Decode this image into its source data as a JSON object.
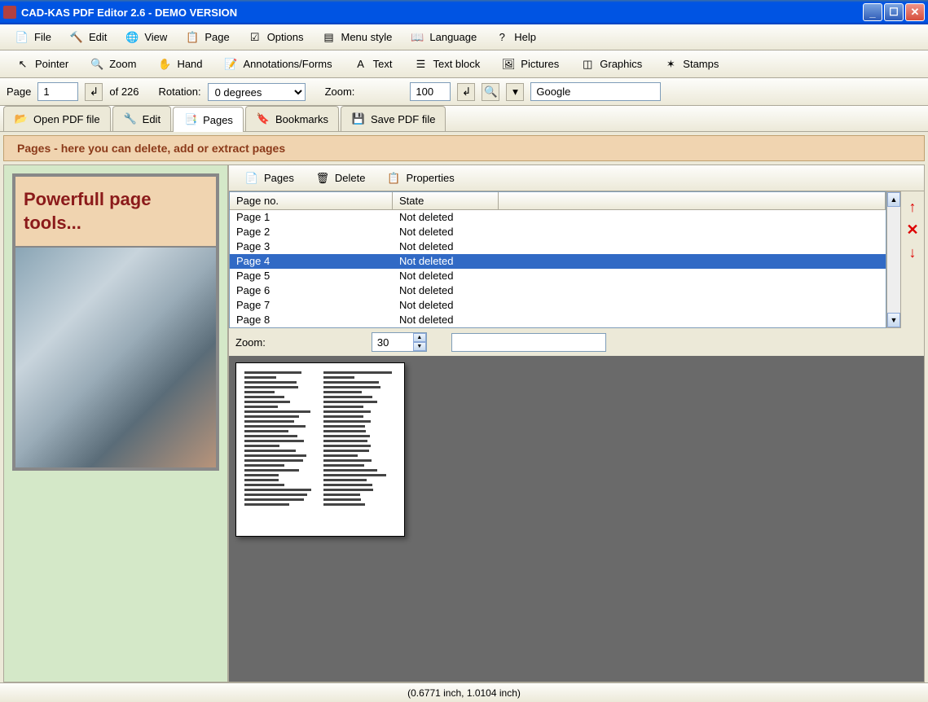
{
  "title": "CAD-KAS PDF Editor 2.6 - DEMO VERSION",
  "menubar": [
    {
      "label": "File",
      "icon": "file-icon"
    },
    {
      "label": "Edit",
      "icon": "edit-icon"
    },
    {
      "label": "View",
      "icon": "view-icon"
    },
    {
      "label": "Page",
      "icon": "page-icon"
    },
    {
      "label": "Options",
      "icon": "options-icon"
    },
    {
      "label": "Menu style",
      "icon": "menustyle-icon"
    },
    {
      "label": "Language",
      "icon": "language-icon"
    },
    {
      "label": "Help",
      "icon": "help-icon"
    }
  ],
  "toolbar": [
    {
      "label": "Pointer",
      "icon": "pointer-icon"
    },
    {
      "label": "Zoom",
      "icon": "zoom-icon"
    },
    {
      "label": "Hand",
      "icon": "hand-icon"
    },
    {
      "label": "Annotations/Forms",
      "icon": "annotations-icon"
    },
    {
      "label": "Text",
      "icon": "text-icon"
    },
    {
      "label": "Text block",
      "icon": "textblock-icon"
    },
    {
      "label": "Pictures",
      "icon": "pictures-icon"
    },
    {
      "label": "Graphics",
      "icon": "graphics-icon"
    },
    {
      "label": "Stamps",
      "icon": "stamps-icon"
    }
  ],
  "controlbar": {
    "page_label": "Page",
    "page_value": "1",
    "of_label": "of 226",
    "rotation_label": "Rotation:",
    "rotation_value": "0 degrees",
    "zoom_label": "Zoom:",
    "zoom_value": "100",
    "search_value": "Google"
  },
  "tabs": [
    {
      "label": "Open PDF file",
      "icon": "open-icon",
      "active": false
    },
    {
      "label": "Edit",
      "icon": "edit-tab-icon",
      "active": false
    },
    {
      "label": "Pages",
      "icon": "pages-tab-icon",
      "active": true
    },
    {
      "label": "Bookmarks",
      "icon": "bookmarks-icon",
      "active": false
    },
    {
      "label": "Save PDF file",
      "icon": "save-icon",
      "active": false
    }
  ],
  "banner": "Pages - here you can delete, add or extract pages",
  "promo": "Powerfull page tools...",
  "pages_toolbar": [
    {
      "label": "Pages",
      "icon": "pages-icon"
    },
    {
      "label": "Delete",
      "icon": "delete-icon"
    },
    {
      "label": "Properties",
      "icon": "properties-icon"
    }
  ],
  "list": {
    "headers": [
      "Page no.",
      "State"
    ],
    "rows": [
      {
        "page": "Page 1",
        "state": "Not deleted",
        "selected": false
      },
      {
        "page": "Page 2",
        "state": "Not deleted",
        "selected": false
      },
      {
        "page": "Page 3",
        "state": "Not deleted",
        "selected": false
      },
      {
        "page": "Page 4",
        "state": "Not deleted",
        "selected": true
      },
      {
        "page": "Page 5",
        "state": "Not deleted",
        "selected": false
      },
      {
        "page": "Page 6",
        "state": "Not deleted",
        "selected": false
      },
      {
        "page": "Page 7",
        "state": "Not deleted",
        "selected": false
      },
      {
        "page": "Page 8",
        "state": "Not deleted",
        "selected": false
      }
    ]
  },
  "zoom_panel": {
    "label": "Zoom:",
    "value": "30"
  },
  "statusbar": "(0.6771 inch, 1.0104 inch)"
}
